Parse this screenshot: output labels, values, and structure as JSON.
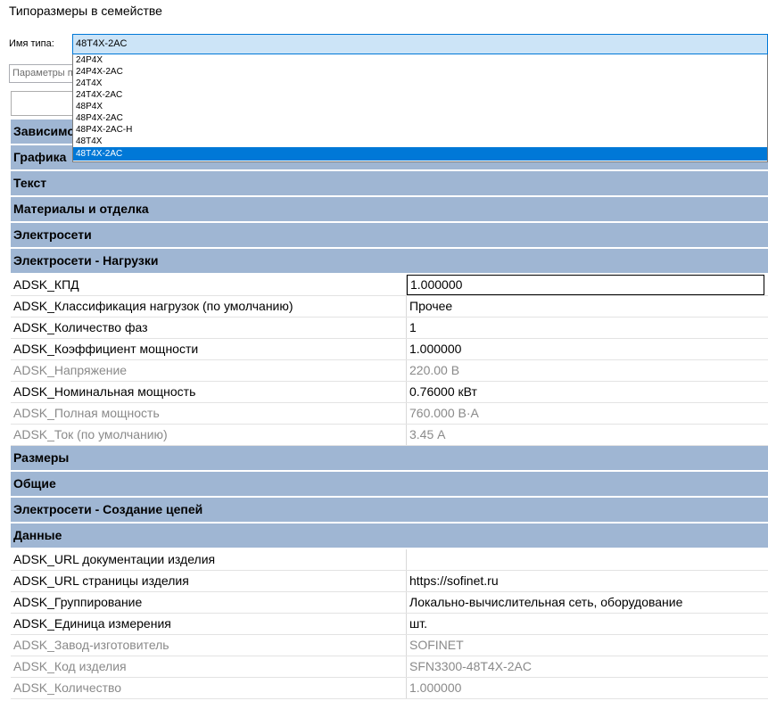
{
  "window": {
    "title": "Типоразмеры в семействе"
  },
  "type_selector": {
    "label": "Имя типа:",
    "value": "48T4X-2AC",
    "options": [
      "24P4X",
      "24P4X-2AC",
      "24T4X",
      "24T4X-2AC",
      "48P4X",
      "48P4X-2AC",
      "48P4X-2AC-H",
      "48T4X",
      "48T4X-2AC"
    ]
  },
  "search": {
    "placeholder": "Параметры поиска"
  },
  "groups": [
    {
      "label": "Зависимости"
    },
    {
      "label": "Графика"
    },
    {
      "label": "Текст"
    },
    {
      "label": "Материалы и отделка"
    },
    {
      "label": "Электросети"
    },
    {
      "label": "Электросети - Нагрузки"
    },
    {
      "label": "Размеры"
    },
    {
      "label": "Общие"
    },
    {
      "label": "Электросети - Создание цепей"
    },
    {
      "label": "Данные"
    }
  ],
  "loads_params": [
    {
      "name": "ADSK_КПД",
      "value": "1.000000"
    },
    {
      "name": "ADSK_Классификация нагрузок (по умолчанию)",
      "value": "Прочее"
    },
    {
      "name": "ADSK_Количество фаз",
      "value": "1"
    },
    {
      "name": "ADSK_Коэффициент мощности",
      "value": "1.000000"
    },
    {
      "name": "ADSK_Напряжение",
      "value": "220.00 В"
    },
    {
      "name": "ADSK_Номинальная мощность",
      "value": "0.76000 кВт"
    },
    {
      "name": "ADSK_Полная мощность",
      "value": "760.000 В·А"
    },
    {
      "name": "ADSK_Ток (по умолчанию)",
      "value": "3.45 А"
    }
  ],
  "data_params": [
    {
      "name": "ADSK_URL документации изделия",
      "value": ""
    },
    {
      "name": "ADSK_URL страницы изделия",
      "value": "https://sofinet.ru"
    },
    {
      "name": "ADSK_Группирование",
      "value": "Локально-вычислительная сеть, оборудование"
    },
    {
      "name": "ADSK_Единица измерения",
      "value": "шт."
    },
    {
      "name": "ADSK_Завод-изготовитель",
      "value": "SOFINET"
    },
    {
      "name": "ADSK_Код изделия",
      "value": "SFN3300-48T4X-2AC"
    },
    {
      "name": "ADSK_Количество",
      "value": "1.000000"
    }
  ]
}
